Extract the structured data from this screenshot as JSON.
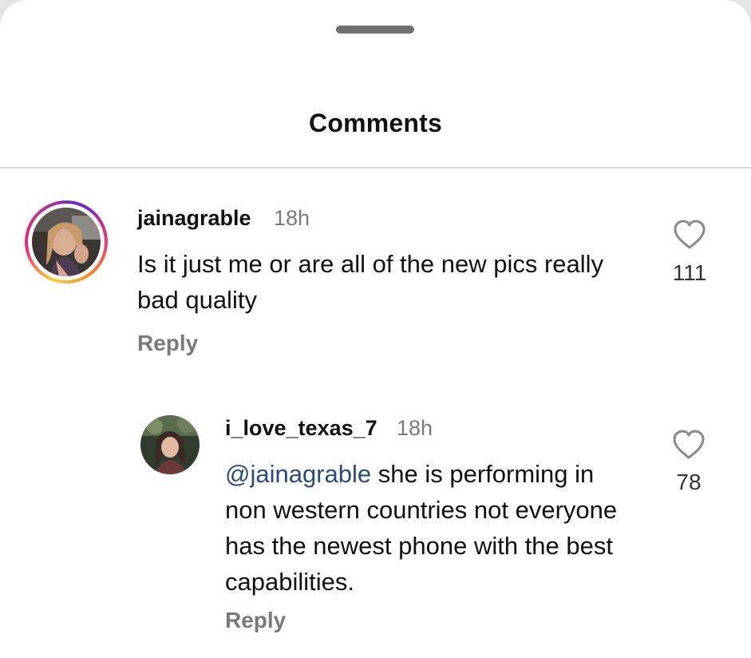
{
  "sheet": {
    "title": "Comments"
  },
  "comments": [
    {
      "username": "jainagrable",
      "time": "18h",
      "text": "Is it just me or are all of the new pics really bad quality",
      "reply_label": "Reply",
      "likes": "111",
      "avatar_icon": "profile-photo-with-story-ring"
    },
    {
      "username": "i_love_texas_7",
      "time": "18h",
      "mention": "@jainagrable",
      "text": "she is performing in non western countries not everyone has the newest phone with the best capabilities.",
      "reply_label": "Reply",
      "likes": "78",
      "avatar_icon": "profile-photo"
    }
  ],
  "colors": {
    "mention": "#2b4a7f",
    "muted": "#7a7a7a",
    "text": "#111111",
    "story_ring": [
      "#f9ce34",
      "#ee2a7b",
      "#6228d7"
    ]
  },
  "icons": {
    "like": "heart-outline-icon",
    "grabber": "drag-handle"
  }
}
